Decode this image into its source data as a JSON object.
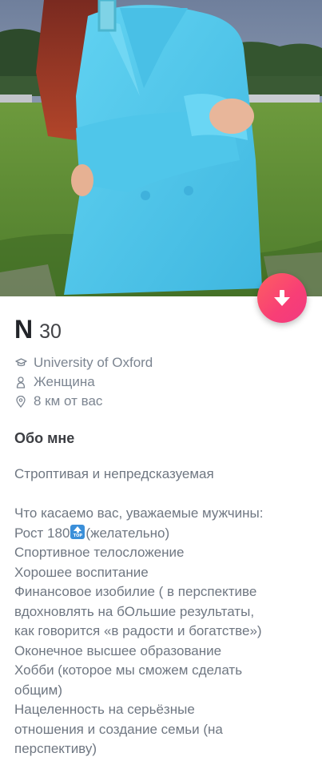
{
  "profile": {
    "name": "N",
    "age": "30",
    "school": "University of Oxford",
    "gender": "Женщина",
    "distance": "8 км от вас"
  },
  "icons": {
    "school": "graduation-cap-icon",
    "gender": "person-icon",
    "distance": "location-pin-icon",
    "fab": "arrow-down-icon"
  },
  "colors": {
    "fab_gradient_start": "#fd5f61",
    "fab_gradient_end": "#f13a80",
    "name": "#222429",
    "meta": "#7c8591",
    "jacket": "#52c9ec"
  },
  "about": {
    "title": "Обо мне",
    "tagline": "Строптивая и непредсказуемая",
    "lines": [
      "Что касаемо вас, уважаемые мужчины:",
      "Рост 180",
      "(желательно)",
      "Спортивное телосложение",
      "Хорошее воспитание",
      "Финансовое изобилие ( в перспективе",
      "вдохновлять на бОльшие результаты,",
      "как говорится «в радости и богатстве»)",
      "Оконечное высшее образование",
      "Хобби (которое мы сможем сделать",
      "общим)",
      "Нацеленность на серьёзные",
      "отношения и создание семьи (на",
      "перспективу)"
    ],
    "badge_text": "TOP"
  }
}
